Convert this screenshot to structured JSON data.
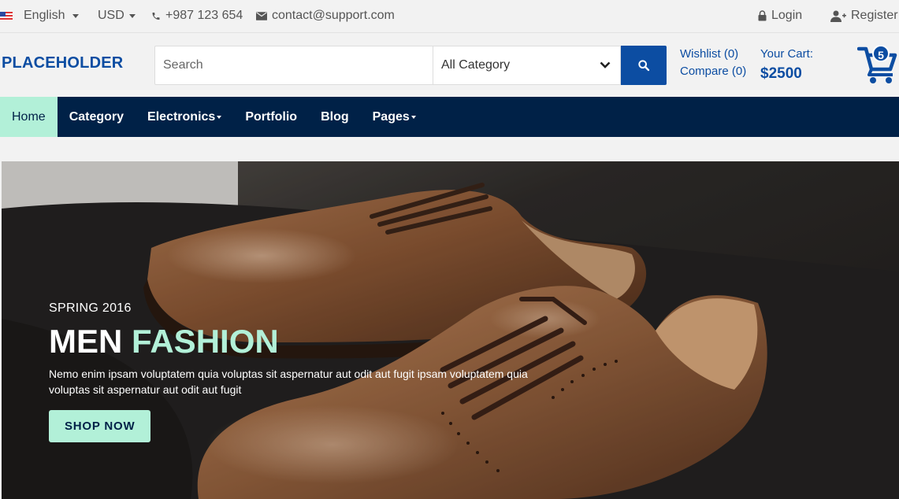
{
  "topbar": {
    "language": "English",
    "currency": "USD",
    "phone": "+987 123 654",
    "email": "contact@support.com",
    "login": "Login",
    "register": "Register"
  },
  "header": {
    "logo": "PLACEHOLDER",
    "search_placeholder": "Search",
    "category_selected": "All Category",
    "wishlist": "Wishlist (0)",
    "compare": "Compare (0)",
    "cart_label": "Your Cart:",
    "cart_amount": "$2500",
    "cart_count": "5"
  },
  "nav": {
    "items": [
      {
        "label": "Home"
      },
      {
        "label": "Category"
      },
      {
        "label": "Electronics"
      },
      {
        "label": "Portfolio"
      },
      {
        "label": "Blog"
      },
      {
        "label": "Pages"
      }
    ]
  },
  "hero": {
    "subtitle": "SPRING 2016",
    "title_main": "MEN",
    "title_accent": "FASHION",
    "description": "Nemo enim ipsam voluptatem quia voluptas sit aspernatur aut odit aut fugit ipsam voluptatem quia voluptas sit aspernatur aut odit aut fugit",
    "cta": "SHOP NOW"
  },
  "colors": {
    "brand": "#0c4da2",
    "nav_bg": "#002147",
    "accent": "#b2f0d8"
  }
}
